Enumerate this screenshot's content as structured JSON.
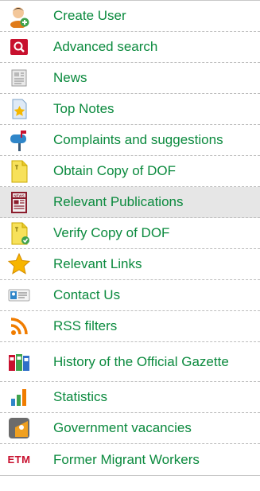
{
  "menu": {
    "items": [
      {
        "label": "Create User",
        "icon": "user-add-icon"
      },
      {
        "label": "Advanced search",
        "icon": "search-icon"
      },
      {
        "label": "News",
        "icon": "newspaper-icon"
      },
      {
        "label": "Top Notes",
        "icon": "star-document-icon"
      },
      {
        "label": "Complaints and suggestions",
        "icon": "mailbox-icon"
      },
      {
        "label": "Obtain Copy of DOF",
        "icon": "document-icon"
      },
      {
        "label": "Relevant Publications",
        "icon": "news-publication-icon"
      },
      {
        "label": "Verify Copy of DOF",
        "icon": "document-check-icon"
      },
      {
        "label": "Relevant Links",
        "icon": "star-icon"
      },
      {
        "label": "Contact Us",
        "icon": "contact-card-icon"
      },
      {
        "label": "RSS filters",
        "icon": "rss-icon"
      },
      {
        "label": "History of the Official Gazette",
        "icon": "binders-icon"
      },
      {
        "label": "Statistics",
        "icon": "bar-chart-icon"
      },
      {
        "label": "Government vacancies",
        "icon": "vacancies-icon"
      },
      {
        "label": "Former Migrant Workers",
        "icon": "etm-logo",
        "logo_text": "ETM"
      }
    ]
  },
  "colors": {
    "link": "#0b8a3e",
    "shaded_row": "#e6e6e6",
    "separator": "#bdbdbd"
  }
}
